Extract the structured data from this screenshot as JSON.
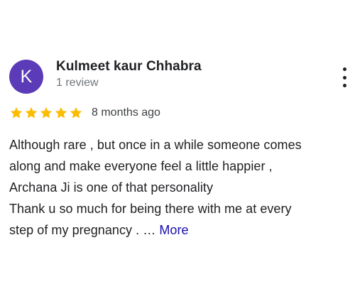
{
  "reviewer": {
    "initial": "K",
    "name": "Kulmeet kaur Chhabra",
    "review_count": "1 review",
    "avatar_color": "#5b3bb8"
  },
  "rating": {
    "stars": 5,
    "max_stars": 5,
    "star_color": "#fbbc04",
    "timestamp": "8 months ago"
  },
  "review": {
    "lines": [
      "Although rare , but once in a while someone comes",
      "along and make everyone feel a little happier ,",
      "Archana Ji is one of that personality",
      "Thank u so much for being there with me at every"
    ],
    "last_line": "step of my pregnancy . …",
    "more_label": "More"
  },
  "menu": {
    "icon": "more-vert-icon"
  }
}
